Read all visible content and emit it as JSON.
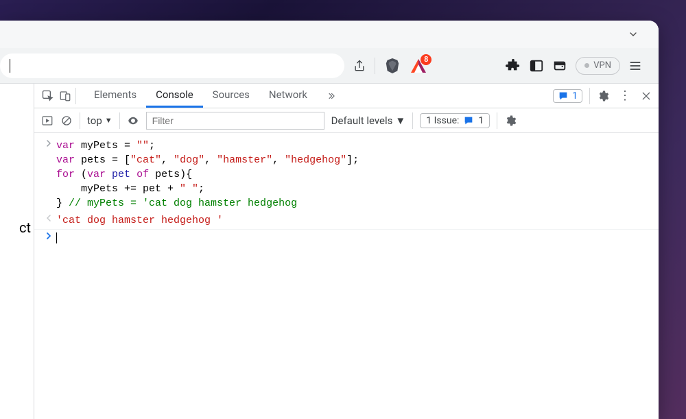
{
  "browser": {
    "badge_count": "8",
    "vpn_label": "VPN"
  },
  "page": {
    "fragment": "ct"
  },
  "devtools": {
    "tabs": [
      "Elements",
      "Console",
      "Sources",
      "Network"
    ],
    "active_tab": "Console",
    "messages_count": "1",
    "console_toolbar": {
      "context": "top",
      "filter_placeholder": "Filter",
      "levels_label": "Default levels",
      "issues_label": "1 Issue:",
      "issues_count": "1"
    },
    "code": {
      "line1_a": "var",
      "line1_b": " myPets = ",
      "line1_c": "\"\"",
      "line1_d": ";",
      "line2_a": "var",
      "line2_b": " pets = [",
      "line2_c": "\"cat\"",
      "line2_d": ", ",
      "line2_e": "\"dog\"",
      "line2_f": ", ",
      "line2_g": "\"hamster\"",
      "line2_h": ", ",
      "line2_i": "\"hedgehog\"",
      "line2_j": "];",
      "line3_a": "for",
      "line3_b": " (",
      "line3_c": "var",
      "line3_d": " pet ",
      "line3_e": "of",
      "line3_f": " pets){",
      "line4_a": "    myPets += pet + ",
      "line4_b": "\" \"",
      "line4_c": ";",
      "line5_a": "} ",
      "line5_b": "// myPets = 'cat dog hamster hedgehog"
    },
    "result": "'cat dog hamster hedgehog '"
  }
}
